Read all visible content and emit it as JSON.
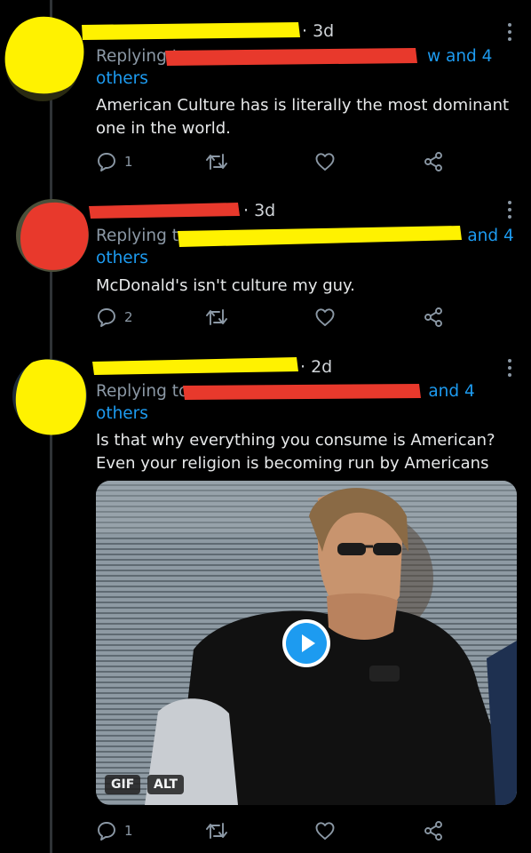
{
  "tweets": [
    {
      "time": "· 3d",
      "replying_prefix": "Replying t",
      "replying_suffix": "w and 4",
      "replying_others": "others",
      "text": "American Culture has is literally the most dominant one in the world.",
      "reply_count": "1",
      "retweet_count": "",
      "like_count": ""
    },
    {
      "time": "· 3d",
      "replying_prefix": "Replying to",
      "replying_suffix": "and 4",
      "replying_others": "others",
      "text": "McDonald's isn't culture my guy.",
      "reply_count": "2",
      "retweet_count": "",
      "like_count": ""
    },
    {
      "time": "· 2d",
      "replying_prefix": "Replying to",
      "replying_suffix": "and 4",
      "replying_others": "others",
      "text": "Is that why everything you consume is American? Even your religion is becoming run by Americans",
      "media": {
        "badge_gif": "GIF",
        "badge_alt": "ALT"
      },
      "reply_count": "1",
      "retweet_count": "",
      "like_count": ""
    }
  ],
  "colors": {
    "background": "#000000",
    "link": "#1d9bf0",
    "muted": "#8b98a5",
    "redaction_yellow": "#fff200",
    "redaction_red": "#e8392c"
  },
  "icons": [
    "reply-icon",
    "retweet-icon",
    "like-icon",
    "share-icon",
    "more-icon",
    "play-icon"
  ]
}
